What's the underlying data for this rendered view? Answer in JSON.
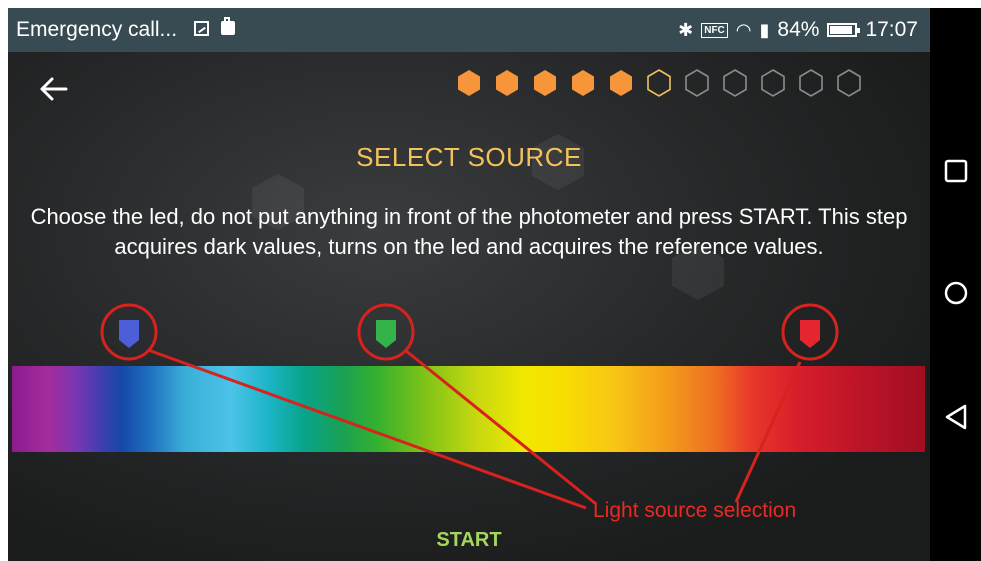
{
  "status_bar": {
    "title": "Emergency call...",
    "nfc_label": "NFC",
    "battery_text": "84%",
    "battery_level": 0.84,
    "time": "17:07"
  },
  "header": {
    "progress": {
      "total": 11,
      "completed": 5,
      "current": 6
    }
  },
  "main": {
    "title": "SELECT SOURCE",
    "instruction": "Choose the led, do not put anything in front of the photometer and press START. This step acquires dark values, turns on the led and acquires the reference values.",
    "leds": [
      {
        "name": "blue",
        "color": "#4c5fd8"
      },
      {
        "name": "green",
        "color": "#34b34a"
      },
      {
        "name": "red",
        "color": "#e5262e"
      }
    ],
    "annotation": "Light source selection",
    "start_label": "START"
  },
  "colors": {
    "accent": "#f4c25a",
    "progress_done": "#f7953b",
    "annotation": "#e82a22",
    "start": "#a4d65e",
    "status_bar": "#384b53"
  }
}
